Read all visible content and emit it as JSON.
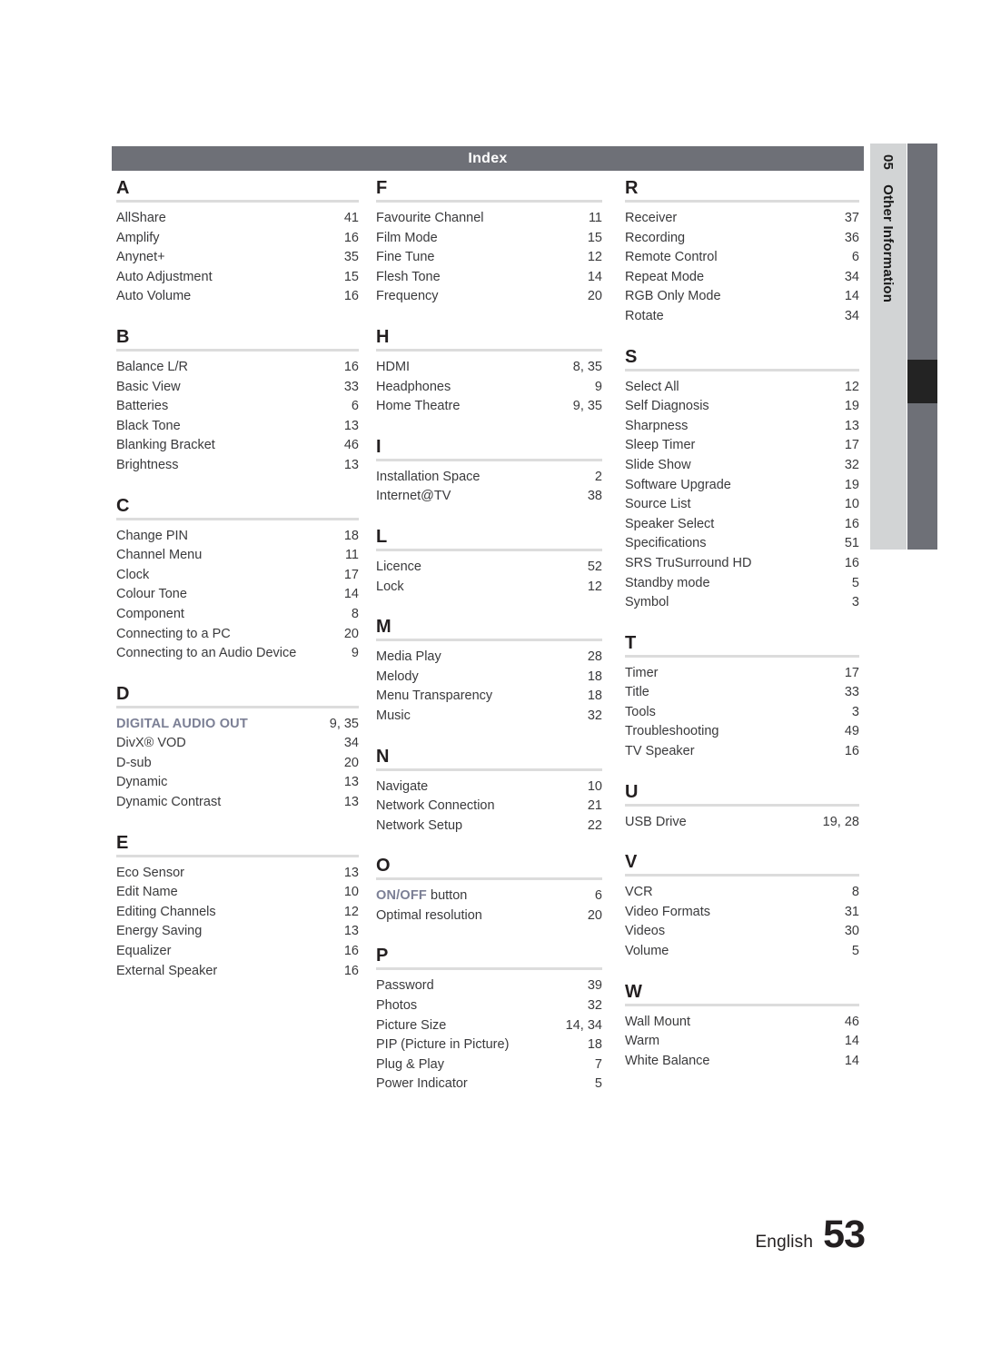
{
  "header": {
    "title": "Index"
  },
  "side_tab": {
    "number": "05",
    "label": "Other Information"
  },
  "footer": {
    "language": "English",
    "page_number": "53"
  },
  "colors": {
    "header_bar": "#6e7077",
    "tab_light": "#d2d4d5",
    "tab_dark": "#6e7077",
    "tab_marker": "#232323",
    "rule": "#dcdcdc",
    "body_text": "#3a3a3c",
    "highlight_text": "#7b7f95"
  },
  "columns": [
    {
      "sections": [
        {
          "letter": "A",
          "entries": [
            {
              "term": "AllShare",
              "page": "41"
            },
            {
              "term": "Amplify",
              "page": "16"
            },
            {
              "term": "Anynet+",
              "page": "35"
            },
            {
              "term": "Auto Adjustment",
              "page": "15"
            },
            {
              "term": "Auto Volume",
              "page": "16"
            }
          ]
        },
        {
          "letter": "B",
          "entries": [
            {
              "term": "Balance  L/R",
              "page": "16"
            },
            {
              "term": "Basic View",
              "page": "33"
            },
            {
              "term": "Batteries",
              "page": "6"
            },
            {
              "term": "Black Tone",
              "page": "13"
            },
            {
              "term": "Blanking Bracket",
              "page": "46"
            },
            {
              "term": "Brightness",
              "page": "13"
            }
          ]
        },
        {
          "letter": "C",
          "entries": [
            {
              "term": "Change PIN",
              "page": "18"
            },
            {
              "term": "Channel Menu",
              "page": "11"
            },
            {
              "term": "Clock",
              "page": "17"
            },
            {
              "term": "Colour Tone",
              "page": "14"
            },
            {
              "term": "Component",
              "page": "8"
            },
            {
              "term": "Connecting to a PC",
              "page": "20"
            },
            {
              "term": "Connecting to an Audio Device",
              "page": "9"
            }
          ]
        },
        {
          "letter": "D",
          "entries": [
            {
              "term": "DIGITAL AUDIO OUT",
              "page": "9, 35",
              "highlight": true
            },
            {
              "term": "DivX® VOD",
              "page": "34"
            },
            {
              "term": "D-sub",
              "page": "20"
            },
            {
              "term": "Dynamic",
              "page": "13"
            },
            {
              "term": "Dynamic Contrast",
              "page": "13"
            }
          ]
        },
        {
          "letter": "E",
          "entries": [
            {
              "term": "Eco Sensor",
              "page": "13"
            },
            {
              "term": "Edit Name",
              "page": "10"
            },
            {
              "term": "Editing Channels",
              "page": "12"
            },
            {
              "term": "Energy Saving",
              "page": "13"
            },
            {
              "term": "Equalizer",
              "page": "16"
            },
            {
              "term": "External Speaker",
              "page": "16"
            }
          ]
        }
      ]
    },
    {
      "sections": [
        {
          "letter": "F",
          "entries": [
            {
              "term": "Favourite Channel",
              "page": "11"
            },
            {
              "term": "Film Mode",
              "page": "15"
            },
            {
              "term": "Fine Tune",
              "page": "12"
            },
            {
              "term": "Flesh Tone",
              "page": "14"
            },
            {
              "term": "Frequency",
              "page": "20"
            }
          ]
        },
        {
          "letter": "H",
          "entries": [
            {
              "term": "HDMI",
              "page": "8, 35"
            },
            {
              "term": "Headphones",
              "page": "9"
            },
            {
              "term": "Home Theatre",
              "page": "9, 35"
            }
          ]
        },
        {
          "letter": "I",
          "entries": [
            {
              "term": "Installation Space",
              "page": "2"
            },
            {
              "term": "Internet@TV",
              "page": "38"
            }
          ]
        },
        {
          "letter": "L",
          "entries": [
            {
              "term": "Licence",
              "page": "52"
            },
            {
              "term": "Lock",
              "page": "12"
            }
          ]
        },
        {
          "letter": "M",
          "entries": [
            {
              "term": "Media Play",
              "page": "28"
            },
            {
              "term": "Melody",
              "page": "18"
            },
            {
              "term": "Menu Transparency",
              "page": "18"
            },
            {
              "term": "Music",
              "page": "32"
            }
          ]
        },
        {
          "letter": "N",
          "entries": [
            {
              "term": "Navigate",
              "page": "10"
            },
            {
              "term": "Network Connection",
              "page": "21"
            },
            {
              "term": "Network Setup",
              "page": "22"
            }
          ]
        },
        {
          "letter": "O",
          "entries": [
            {
              "term": "ON/OFF",
              "term_suffix": " button",
              "page": "6",
              "highlight": true
            },
            {
              "term": "Optimal resolution",
              "page": "20"
            }
          ]
        },
        {
          "letter": "P",
          "entries": [
            {
              "term": "Password",
              "page": "39"
            },
            {
              "term": "Photos",
              "page": "32"
            },
            {
              "term": "Picture Size",
              "page": "14, 34"
            },
            {
              "term": "PIP (Picture in Picture)",
              "page": "18"
            },
            {
              "term": "Plug & Play",
              "page": "7"
            },
            {
              "term": "Power Indicator",
              "page": "5"
            }
          ]
        }
      ]
    },
    {
      "sections": [
        {
          "letter": "R",
          "entries": [
            {
              "term": "Receiver",
              "page": "37"
            },
            {
              "term": "Recording",
              "page": "36"
            },
            {
              "term": "Remote Control",
              "page": "6"
            },
            {
              "term": "Repeat Mode",
              "page": "34"
            },
            {
              "term": "RGB Only Mode",
              "page": "14"
            },
            {
              "term": "Rotate",
              "page": "34"
            }
          ]
        },
        {
          "letter": "S",
          "entries": [
            {
              "term": "Select All",
              "page": "12"
            },
            {
              "term": "Self Diagnosis",
              "page": "19"
            },
            {
              "term": "Sharpness",
              "page": "13"
            },
            {
              "term": "Sleep Timer",
              "page": "17"
            },
            {
              "term": "Slide Show",
              "page": "32"
            },
            {
              "term": "Software Upgrade",
              "page": "19"
            },
            {
              "term": "Source List",
              "page": "10"
            },
            {
              "term": "Speaker Select",
              "page": "16"
            },
            {
              "term": "Specifications",
              "page": "51"
            },
            {
              "term": "SRS TruSurround HD",
              "page": "16"
            },
            {
              "term": "Standby mode",
              "page": "5"
            },
            {
              "term": "Symbol",
              "page": "3"
            }
          ]
        },
        {
          "letter": "T",
          "entries": [
            {
              "term": "Timer",
              "page": "17"
            },
            {
              "term": "Title",
              "page": "33"
            },
            {
              "term": "Tools",
              "page": "3"
            },
            {
              "term": "Troubleshooting",
              "page": "49"
            },
            {
              "term": "TV Speaker",
              "page": "16"
            }
          ]
        },
        {
          "letter": "U",
          "entries": [
            {
              "term": "USB Drive",
              "page": "19, 28"
            }
          ]
        },
        {
          "letter": "V",
          "entries": [
            {
              "term": "VCR",
              "page": "8"
            },
            {
              "term": "Video Formats",
              "page": "31"
            },
            {
              "term": "Videos",
              "page": "30"
            },
            {
              "term": "Volume",
              "page": "5"
            }
          ]
        },
        {
          "letter": "W",
          "entries": [
            {
              "term": "Wall Mount",
              "page": "46"
            },
            {
              "term": "Warm",
              "page": "14"
            },
            {
              "term": "White Balance",
              "page": "14"
            }
          ]
        }
      ]
    }
  ]
}
